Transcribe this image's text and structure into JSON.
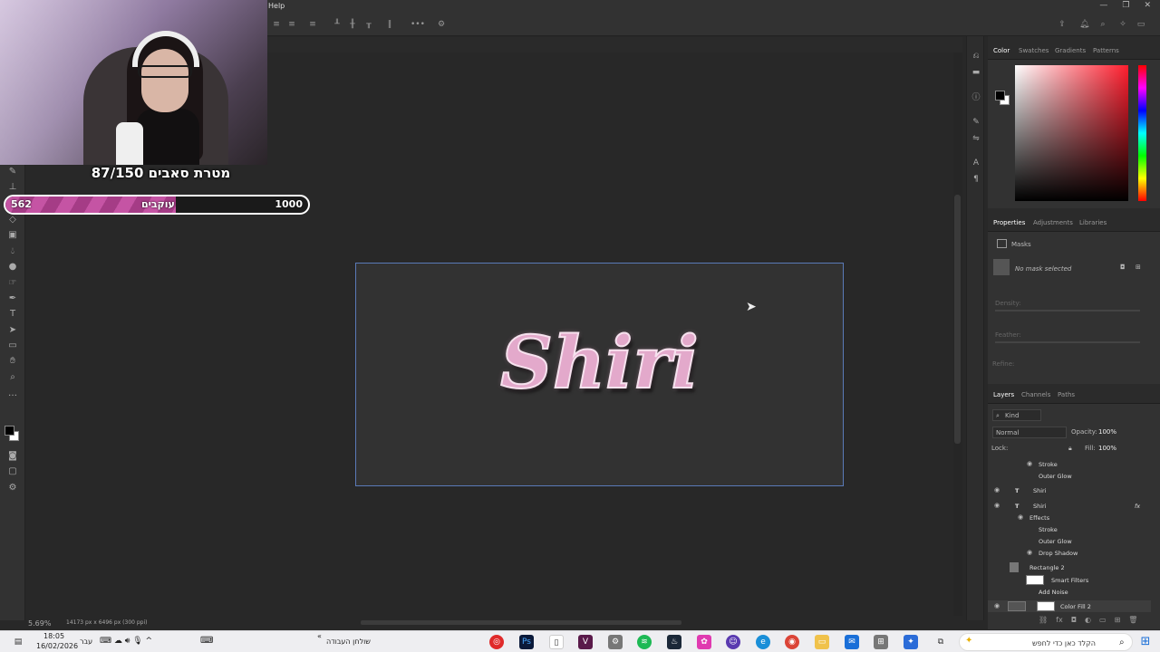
{
  "app": {
    "menu_help": "Help"
  },
  "overlay": {
    "sub_goal_title": "מטרת סאבים 87/150",
    "followers_current": "562",
    "followers_label": "עוקבים",
    "followers_goal": "1000",
    "followers_progress_fraction": 0.562
  },
  "canvas": {
    "document_text": "Shiri",
    "text_color": "#e3a9cb",
    "zoom": "5.69%",
    "doc_info": "14173 px x 6496 px (300 ppi)"
  },
  "panels": {
    "color_tabs": [
      "Color",
      "Swatches",
      "Gradients",
      "Patterns"
    ],
    "properties_tabs": [
      "Properties",
      "Adjustments",
      "Libraries"
    ],
    "masks_label": "Masks",
    "no_mask": "No mask selected",
    "density_label": "Density:",
    "feather_label": "Feather:",
    "refine_label": "Refine:",
    "layers_tabs": [
      "Layers",
      "Channels",
      "Paths"
    ],
    "kind_filter": "Kind",
    "blend_mode": "Normal",
    "opacity_label": "Opacity:",
    "opacity_value": "100%",
    "lock_label": "Lock:",
    "fill_label": "Fill:",
    "fill_value": "100%",
    "layers": [
      {
        "name": "Stroke",
        "kind": "effect"
      },
      {
        "name": "Outer Glow",
        "kind": "effect"
      },
      {
        "name": "Shiri",
        "kind": "text"
      },
      {
        "name": "Shiri",
        "kind": "text"
      },
      {
        "name": "Effects",
        "kind": "effects-header"
      },
      {
        "name": "Stroke",
        "kind": "effect"
      },
      {
        "name": "Outer Glow",
        "kind": "effect"
      },
      {
        "name": "Drop Shadow",
        "kind": "effect"
      },
      {
        "name": "Rectangle 2",
        "kind": "smart"
      },
      {
        "name": "Smart Filters",
        "kind": "filter-header"
      },
      {
        "name": "Add Noise",
        "kind": "filter"
      },
      {
        "name": "Color Fill 2",
        "kind": "fill"
      }
    ]
  },
  "taskbar": {
    "time": "18:05",
    "date": "16/02/2026",
    "language": "עבר",
    "desktop_label": "שולחן העבודה",
    "search_placeholder": "הקלד כאן כדי לחפש"
  }
}
